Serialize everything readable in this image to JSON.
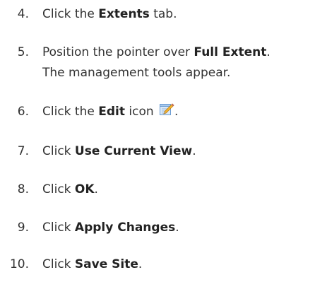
{
  "steps": [
    {
      "number": "4.",
      "pre": "Click the ",
      "bold": "Extents",
      "post": " tab."
    },
    {
      "number": "5.",
      "pre": "Position the pointer over ",
      "bold": "Full Extent",
      "post": ".",
      "line2": "The management tools appear."
    },
    {
      "number": "6.",
      "pre": "Click the ",
      "bold": "Edit",
      "post": " icon",
      "icon": "edit-pencil-icon",
      "post2": "."
    },
    {
      "number": "7.",
      "pre": "Click ",
      "bold": "Use Current View",
      "post": "."
    },
    {
      "number": "8.",
      "pre": "Click ",
      "bold": "OK",
      "post": "."
    },
    {
      "number": "9.",
      "pre": "Click ",
      "bold": "Apply Changes",
      "post": "."
    },
    {
      "number": "10.",
      "pre": "Click ",
      "bold": "Save Site",
      "post": "."
    }
  ]
}
